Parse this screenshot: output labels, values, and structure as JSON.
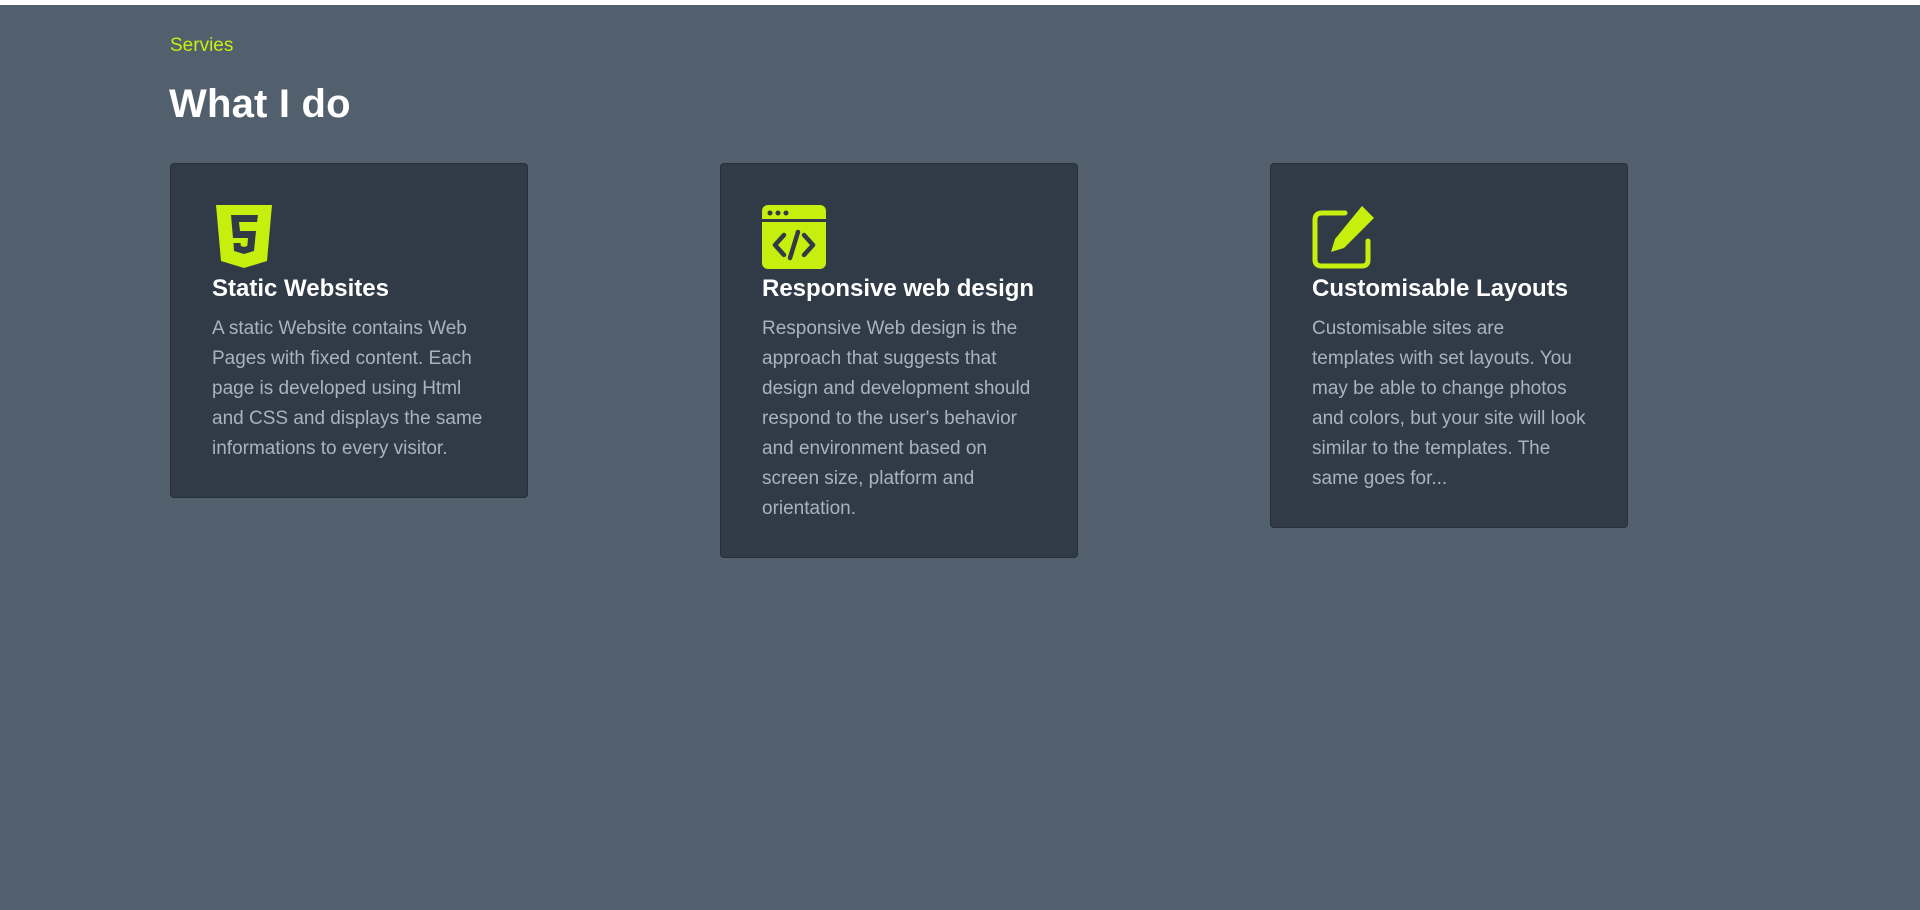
{
  "colors": {
    "accent": "#c6ef0d",
    "background": "#52606d",
    "card_background": "#303b47",
    "heading": "#ffffff",
    "body_text": "#a9b3bd"
  },
  "section": {
    "eyebrow": "Servies",
    "title": "What I do"
  },
  "services": [
    {
      "icon": "html5-icon",
      "title": "Static Websites",
      "description": "A static Website contains Web Pages with fixed content. Each page is developed using Html and CSS and displays the same informations to every visitor."
    },
    {
      "icon": "code-window-icon",
      "title": "Responsive web design",
      "description": "Responsive Web design is the approach that suggests that design and development should respond to the user's behavior and environment based on screen size, platform and orientation."
    },
    {
      "icon": "edit-icon",
      "title": "Customisable Layouts",
      "description": "Customisable sites are templates with set layouts. You may be able to change photos and colors, but your site will look similar to the templates. The same goes for..."
    }
  ]
}
